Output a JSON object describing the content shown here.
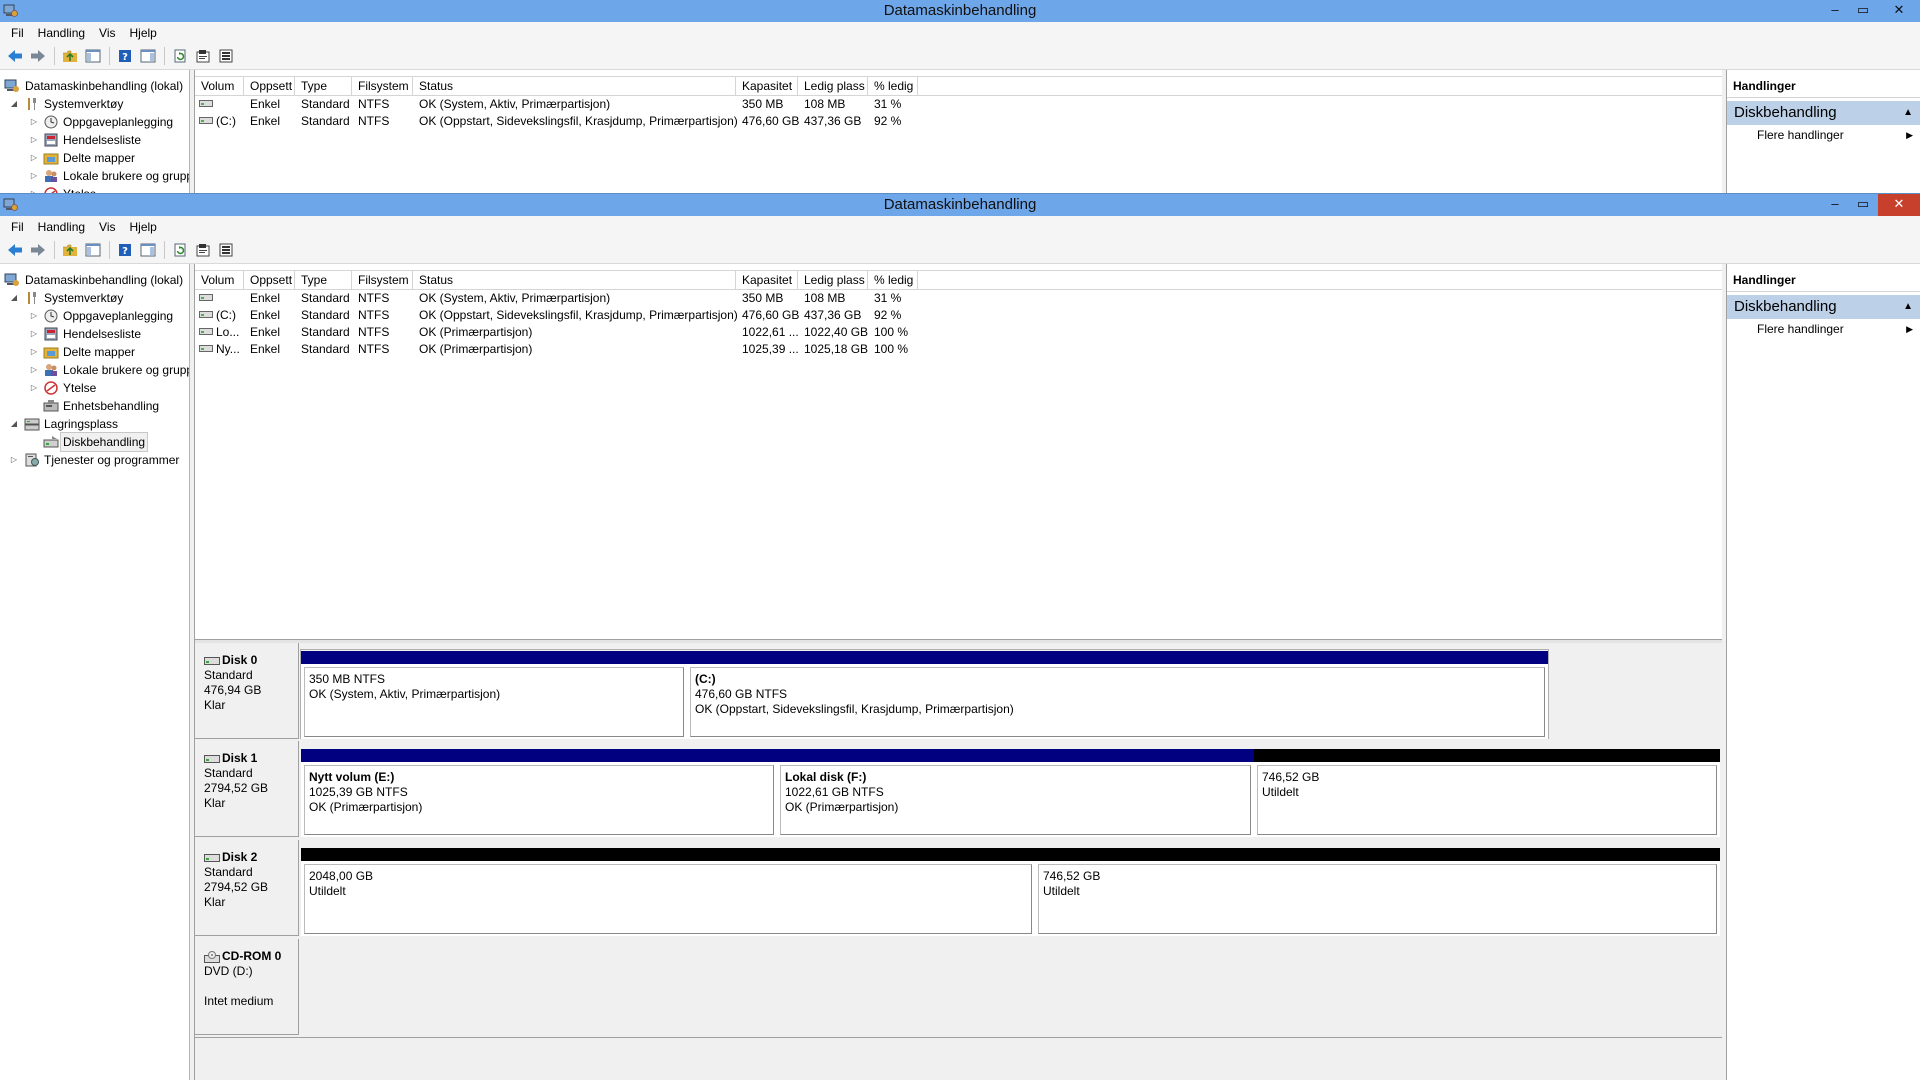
{
  "window": {
    "title": "Datamaskinbehandling",
    "controls": {
      "minimize": "–",
      "maximize": "▭",
      "close": "✕"
    }
  },
  "menu": [
    "Fil",
    "Handling",
    "Vis",
    "Hjelp"
  ],
  "toolbar_icons": [
    "back-arrow-icon",
    "forward-arrow-icon",
    "up-folder-icon",
    "show-hide-tree-icon",
    "help-icon",
    "show-hide-action-icon",
    "refresh-icon",
    "properties-icon",
    "export-list-icon"
  ],
  "tree": {
    "root": "Datamaskinbehandling (lokal)",
    "items": [
      {
        "label": "Systemverktøy",
        "level": 1,
        "expanded": true,
        "icon": "tools-icon"
      },
      {
        "label": "Oppgaveplanlegging",
        "level": 2,
        "expander": true,
        "icon": "clock-icon"
      },
      {
        "label": "Hendelsesliste",
        "level": 2,
        "expander": true,
        "icon": "event-log-icon"
      },
      {
        "label": "Delte mapper",
        "level": 2,
        "expander": true,
        "icon": "shared-folder-icon"
      },
      {
        "label": "Lokale brukere og grupper",
        "level": 2,
        "expander": true,
        "icon": "users-icon"
      },
      {
        "label": "Ytelse",
        "level": 2,
        "expander": true,
        "icon": "performance-icon"
      },
      {
        "label": "Enhetsbehandling",
        "level": 2,
        "expander": false,
        "icon": "device-manager-icon"
      },
      {
        "label": "Lagringsplass",
        "level": 1,
        "expanded": true,
        "icon": "storage-icon"
      },
      {
        "label": "Diskbehandling",
        "level": 2,
        "expander": false,
        "icon": "disk-management-icon",
        "selected": true
      },
      {
        "label": "Tjenester og programmer",
        "level": 1,
        "expander": true,
        "expanded": false,
        "icon": "services-icon"
      }
    ]
  },
  "volume_table": {
    "headers": [
      "Volum",
      "Oppsett",
      "Type",
      "Filsystem",
      "Status",
      "Kapasitet",
      "Ledig plass",
      "% ledig"
    ],
    "rows": [
      [
        "",
        "Enkel",
        "Standard",
        "NTFS",
        "OK (System, Aktiv, Primærpartisjon)",
        "350 MB",
        "108 MB",
        "31 %"
      ],
      [
        "(C:)",
        "Enkel",
        "Standard",
        "NTFS",
        "OK (Oppstart, Sidevekslingsfil, Krasjdump, Primærpartisjon)",
        "476,60 GB",
        "437,36 GB",
        "92 %"
      ],
      [
        "Lo...",
        "Enkel",
        "Standard",
        "NTFS",
        "OK (Primærpartisjon)",
        "1022,61 ...",
        "1022,40 GB",
        "100 %"
      ],
      [
        "Ny...",
        "Enkel",
        "Standard",
        "NTFS",
        "OK (Primærpartisjon)",
        "1025,39 ...",
        "1025,18 GB",
        "100 %"
      ]
    ]
  },
  "back_volume_rows": [
    [
      "",
      "Enkel",
      "Standard",
      "NTFS",
      "OK (System, Aktiv, Primærpartisjon)",
      "350 MB",
      "108 MB",
      "31 %"
    ],
    [
      "(C:)",
      "Enkel",
      "Standard",
      "NTFS",
      "OK (Oppstart, Sidevekslingsfil, Krasjdump, Primærpartisjon)",
      "476,60 GB",
      "437,36 GB",
      "92 %"
    ]
  ],
  "disks": [
    {
      "name": "Disk 0",
      "type": "Standard",
      "size": "476,94 GB",
      "state": "Klar",
      "partitions": [
        {
          "name": "",
          "line1": "350 MB NTFS",
          "line2": "OK (System, Aktiv, Primærpartisjon)",
          "kind": "primary"
        },
        {
          "name": "(C:)",
          "line1": "476,60 GB NTFS",
          "line2": "OK (Oppstart, Sidevekslingsfil, Krasjdump, Primærpartisjon)",
          "kind": "primary"
        }
      ]
    },
    {
      "name": "Disk 1",
      "type": "Standard",
      "size": "2794,52 GB",
      "state": "Klar",
      "partitions": [
        {
          "name": "Nytt volum  (E:)",
          "line1": "1025,39 GB NTFS",
          "line2": "OK (Primærpartisjon)",
          "kind": "primary"
        },
        {
          "name": "Lokal disk  (F:)",
          "line1": "1022,61 GB NTFS",
          "line2": "OK (Primærpartisjon)",
          "kind": "primary"
        },
        {
          "name": "",
          "line1": "746,52 GB",
          "line2": "Utildelt",
          "kind": "unallocated"
        }
      ]
    },
    {
      "name": "Disk 2",
      "type": "Standard",
      "size": "2794,52 GB",
      "state": "Klar",
      "partitions": [
        {
          "name": "",
          "line1": "2048,00 GB",
          "line2": "Utildelt",
          "kind": "unallocated"
        },
        {
          "name": "",
          "line1": "746,52 GB",
          "line2": "Utildelt",
          "kind": "unallocated"
        }
      ]
    }
  ],
  "cdrom": {
    "name": "CD-ROM 0",
    "drive": "DVD (D:)",
    "state": "Intet medium"
  },
  "actions": {
    "header": "Handlinger",
    "group": "Diskbehandling",
    "item": "Flere handlinger"
  },
  "colors": {
    "titlebar": "#6ea6ea",
    "close_button": "#c7402b",
    "primary_partition": "#000080",
    "unallocated": "#000000",
    "action_group": "#bcd0e8"
  }
}
